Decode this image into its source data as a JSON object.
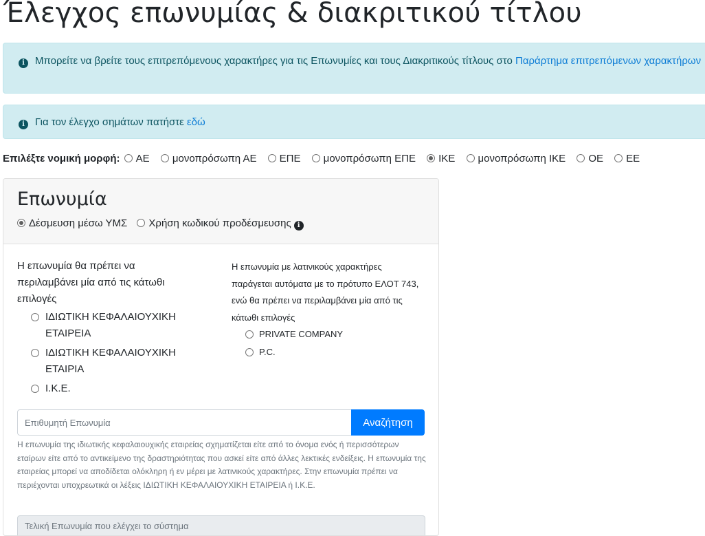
{
  "page": {
    "title": "Έλεγχος επωνυμίας & διακριτικού τίτλου"
  },
  "alerts": {
    "allowed_chars_text": "Μπορείτε να βρείτε τους επιτρεπόμενους χαρακτήρες για τις Επωνυμίες και τους Διακριτικούς τίτλους στο ",
    "allowed_chars_link": "Παράρτημα επιτρεπόμενων χαρακτήρων",
    "trademark_text": "Για τον έλεγχο σημάτων πατήστε ",
    "trademark_link": "εδώ"
  },
  "legal_form": {
    "label": "Επιλέξτε νομική μορφή:",
    "options": [
      {
        "label": "ΑΕ",
        "checked": false
      },
      {
        "label": "μονοπρόσωπη ΑΕ",
        "checked": false
      },
      {
        "label": "ΕΠΕ",
        "checked": false
      },
      {
        "label": "μονοπρόσωπη ΕΠΕ",
        "checked": false
      },
      {
        "label": "ΙΚΕ",
        "checked": true
      },
      {
        "label": "μονοπρόσωπη ΙΚΕ",
        "checked": false
      },
      {
        "label": "ΟΕ",
        "checked": false
      },
      {
        "label": "ΕΕ",
        "checked": false
      }
    ]
  },
  "card": {
    "title": "Επωνυμία",
    "modes": [
      {
        "label": "Δέσμευση μέσω ΥΜΣ",
        "checked": true
      },
      {
        "label": "Χρήση κωδικού προδέσμευσης",
        "checked": false
      }
    ],
    "left_intro": "Η επωνυμία θα πρέπει να περιλαμβάνει μία από τις κάτωθι επιλογές",
    "left_options": [
      "ΙΔΙΩΤΙΚΗ ΚΕΦΑΛΑΙΟΥΧΙΚΗ ΕΤΑΙΡΕΙΑ",
      "ΙΔΙΩΤΙΚΗ ΚΕΦΑΛΑΙΟΥΧΙΚΗ ΕΤΑΙΡΙΑ",
      "Ι.Κ.Ε."
    ],
    "right_intro": "Η επωνυμία με λατινικούς χαρακτήρες παράγεται αυτόματα με το πρότυπο ΕΛΟΤ 743, ενώ θα πρέπει να περιλαμβάνει μία από τις κάτωθι επιλογές",
    "right_options": [
      "PRIVATE COMPANY",
      "P.C."
    ],
    "search_placeholder": "Επιθυμητή Επωνυμία",
    "search_button": "Αναζήτηση",
    "help_text": "Η επωνυμία της ιδιωτικής κεφαλαιουχικής εταιρείας σχηματίζεται είτε από το όνομα ενός ή περισσότερων εταίρων είτε από το αντικείμενο της δραστηριότητας που ασκεί είτε από άλλες λεκτικές ενδείξεις. Η επωνυμία της εταιρείας μπορεί να αποδίδεται ολόκληρη ή εν μέρει με λατινικούς χαρακτήρες. Στην επωνυμία πρέπει να περιέχονται υποχρεωτικά οι λέξεις ΙΔΙΩΤΙΚΗ ΚΕΦΑΛΑΙΟΥΧΙΚΗ ΕΤΑΙΡΕΙΑ ή Ι.Κ.Ε.",
    "final_name_placeholder": "Τελική Επωνυμία που ελέγχει το σύστημα"
  },
  "colors": {
    "alert_bg": "#d1ecf1",
    "alert_text": "#0c5460",
    "link": "#0c7cd5",
    "primary_button": "#007bff"
  }
}
